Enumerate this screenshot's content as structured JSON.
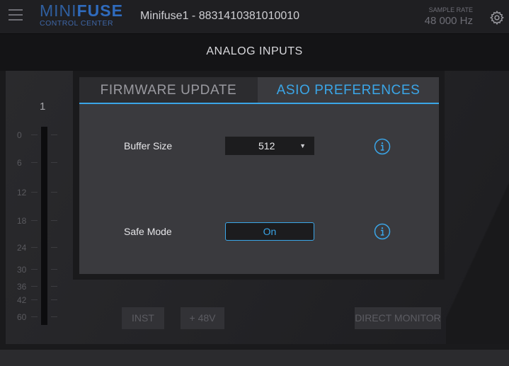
{
  "app": {
    "logo_mini": "MINI",
    "logo_fuse": "FUSE",
    "logo_sub": "CONTROL CENTER",
    "device_name": "Minifuse1 - 8831410381010010",
    "sample_rate_label": "SAMPLE RATE",
    "sample_rate_value": "48 000 Hz"
  },
  "section": {
    "title": "ANALOG INPUTS"
  },
  "channel": {
    "number": "1",
    "scale": [
      "0",
      "6",
      "12",
      "18",
      "24",
      "30",
      "36",
      "42",
      "60"
    ],
    "buttons": {
      "inst": "INST",
      "phantom": "+ 48V",
      "direct_monitor": "DIRECT MONITOR"
    }
  },
  "dialog": {
    "tabs": [
      {
        "label": "FIRMWARE UPDATE",
        "active": false
      },
      {
        "label": "ASIO PREFERENCES",
        "active": true
      }
    ],
    "buffer_size": {
      "label": "Buffer Size",
      "value": "512"
    },
    "safe_mode": {
      "label": "Safe Mode",
      "value": "On"
    }
  },
  "colors": {
    "accent": "#3aa6e8",
    "logo": "#2f6bbd"
  },
  "icons": [
    "hamburger-menu-icon",
    "gear-icon",
    "info-icon",
    "chevron-down-icon"
  ]
}
